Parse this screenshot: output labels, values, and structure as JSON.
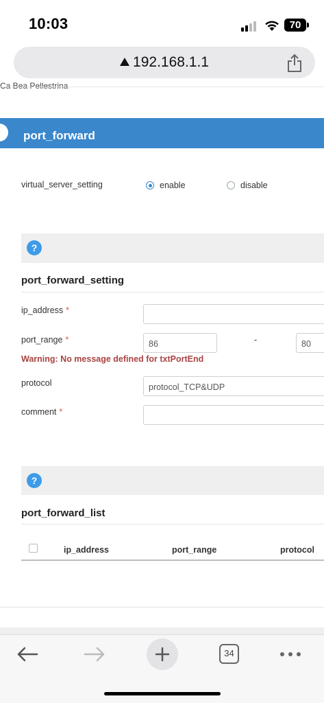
{
  "status_bar": {
    "time": "10:03",
    "battery": "70"
  },
  "browser": {
    "url": "192.168.1.1",
    "tab_count": "34"
  },
  "page": {
    "cut_text": "Ca Bea Pellestrina",
    "header_title": "port_forward",
    "virtual_server": {
      "label": "virtual_server_setting",
      "options": [
        "enable",
        "disable"
      ],
      "selected": "enable"
    },
    "setting": {
      "title": "port_forward_setting",
      "ip_label": "ip_address",
      "ip_value": "",
      "port_label": "port_range",
      "port_start": "86",
      "port_separator": "-",
      "port_end": "80",
      "warning": "Warning: No message defined for txtPortEnd",
      "protocol_label": "protocol",
      "protocol_value": "protocol_TCP&UDP",
      "comment_label": "comment",
      "comment_value": "",
      "required_mark": "*"
    },
    "list": {
      "title": "port_forward_list",
      "columns": [
        "ip_address",
        "port_range",
        "protocol"
      ]
    },
    "help_glyph": "?"
  },
  "colors": {
    "accent": "#3a87cc",
    "warning": "#a94442",
    "required": "#e0524b",
    "help": "#3d9be9"
  }
}
